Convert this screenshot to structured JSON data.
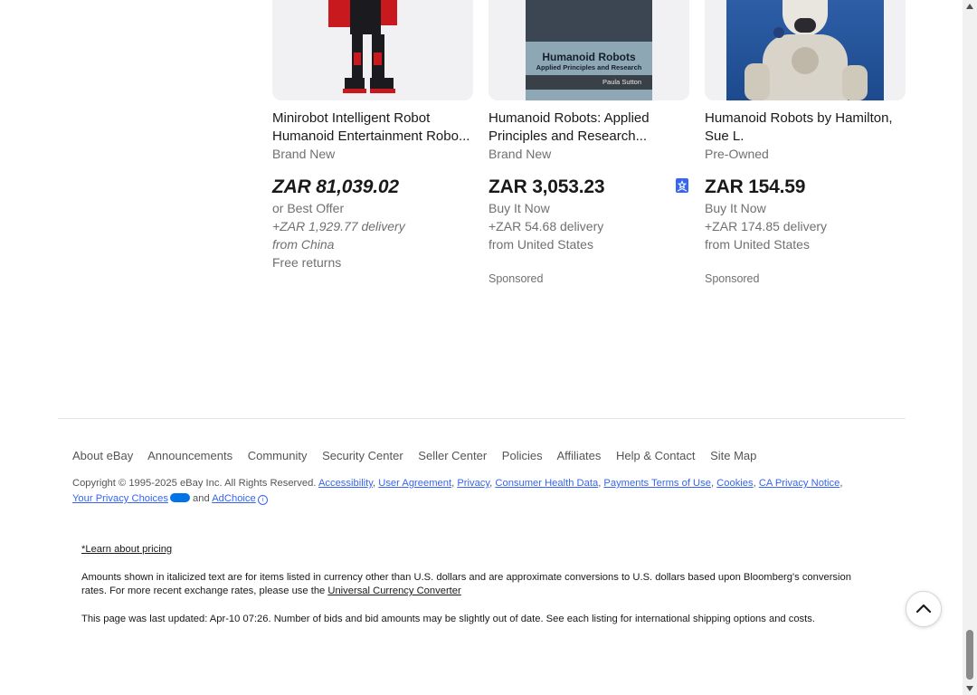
{
  "listings": [
    {
      "title": "Minirobot Intelligent Robot Humanoid Entertainment Robo...",
      "condition": "Brand New",
      "price": "ZAR 81,039.02",
      "purchase": "or Best Offer",
      "delivery": "+ZAR 1,929.77 delivery",
      "origin": "from China",
      "returns": "Free returns",
      "image": "red-black-humanoid-robot"
    },
    {
      "title": "Humanoid Robots: Applied Principles and Research...",
      "condition": "Brand New",
      "price": "ZAR 3,053.23",
      "purchase": "Buy It Now",
      "delivery": "+ZAR 54.68 delivery",
      "origin": "from United States",
      "sponsored": "Sponsored",
      "image": "book-cover",
      "book_title": "Humanoid Robots",
      "book_subtitle": "Applied Principles and Research",
      "book_author": "Paula Sutton"
    },
    {
      "title": "Humanoid Robots by Hamilton, Sue L.",
      "condition": "Pre-Owned",
      "price": "ZAR 154.59",
      "purchase": "Buy It Now",
      "delivery": "+ZAR 174.85 delivery",
      "origin": "from United States",
      "sponsored": "Sponsored",
      "image": "white-space-robot"
    }
  ],
  "footer": {
    "nav": [
      "About eBay",
      "Announcements",
      "Community",
      "Security Center",
      "Seller Center",
      "Policies",
      "Affiliates",
      "Help & Contact",
      "Site Map"
    ],
    "copyright": "Copyright © 1995-2025 eBay Inc. All Rights Reserved.",
    "legal_links": [
      "Accessibility",
      "User Agreement",
      "Privacy",
      "Consumer Health Data",
      "Payments Terms of Use",
      "Cookies",
      "CA Privacy Notice"
    ],
    "privacy_choices": "Your Privacy Choices",
    "and": "and",
    "adchoice": "AdChoice"
  },
  "disclaimer": {
    "learn_pricing": "*Learn about pricing",
    "currency_note": "Amounts shown in italicized text are for items listed in currency other than U.S. dollars and are approximate conversions to U.S. dollars based upon Bloomberg's conversion rates. For more recent exchange rates, please use the",
    "converter_link": "Universal Currency Converter",
    "last_updated": "This page was last updated: Apr-10 07:26. Number of bids and bid amounts may be slightly out of date. See each listing for international shipping options and costs."
  },
  "colors": {
    "accent": "#3665f3",
    "text": "#191919",
    "muted": "#707070"
  },
  "icons": {
    "watch": "bookmark-icon",
    "scroll_top": "chevron-up-icon"
  }
}
